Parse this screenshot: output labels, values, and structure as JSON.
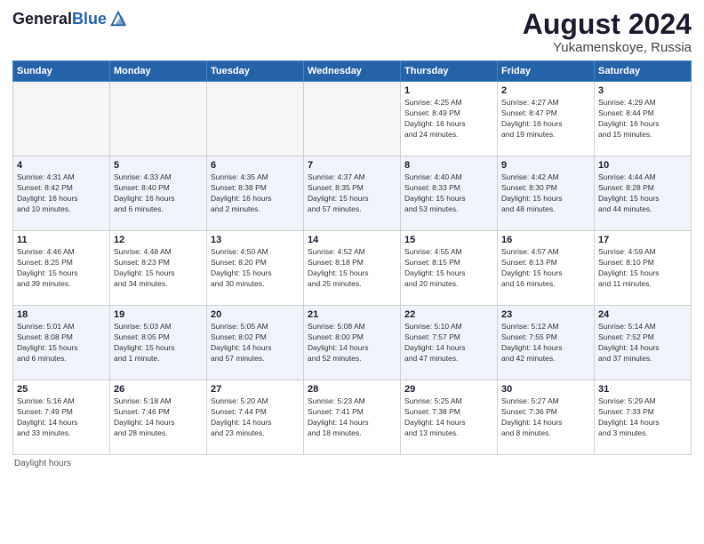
{
  "header": {
    "logo_general": "General",
    "logo_blue": "Blue",
    "month_year": "August 2024",
    "location": "Yukamenskoye, Russia"
  },
  "footer": {
    "daylight_label": "Daylight hours"
  },
  "days_of_week": [
    "Sunday",
    "Monday",
    "Tuesday",
    "Wednesday",
    "Thursday",
    "Friday",
    "Saturday"
  ],
  "weeks": [
    [
      {
        "day": "",
        "info": ""
      },
      {
        "day": "",
        "info": ""
      },
      {
        "day": "",
        "info": ""
      },
      {
        "day": "",
        "info": ""
      },
      {
        "day": "1",
        "info": "Sunrise: 4:25 AM\nSunset: 8:49 PM\nDaylight: 16 hours\nand 24 minutes."
      },
      {
        "day": "2",
        "info": "Sunrise: 4:27 AM\nSunset: 8:47 PM\nDaylight: 16 hours\nand 19 minutes."
      },
      {
        "day": "3",
        "info": "Sunrise: 4:29 AM\nSunset: 8:44 PM\nDaylight: 16 hours\nand 15 minutes."
      }
    ],
    [
      {
        "day": "4",
        "info": "Sunrise: 4:31 AM\nSunset: 8:42 PM\nDaylight: 16 hours\nand 10 minutes."
      },
      {
        "day": "5",
        "info": "Sunrise: 4:33 AM\nSunset: 8:40 PM\nDaylight: 16 hours\nand 6 minutes."
      },
      {
        "day": "6",
        "info": "Sunrise: 4:35 AM\nSunset: 8:38 PM\nDaylight: 16 hours\nand 2 minutes."
      },
      {
        "day": "7",
        "info": "Sunrise: 4:37 AM\nSunset: 8:35 PM\nDaylight: 15 hours\nand 57 minutes."
      },
      {
        "day": "8",
        "info": "Sunrise: 4:40 AM\nSunset: 8:33 PM\nDaylight: 15 hours\nand 53 minutes."
      },
      {
        "day": "9",
        "info": "Sunrise: 4:42 AM\nSunset: 8:30 PM\nDaylight: 15 hours\nand 48 minutes."
      },
      {
        "day": "10",
        "info": "Sunrise: 4:44 AM\nSunset: 8:28 PM\nDaylight: 15 hours\nand 44 minutes."
      }
    ],
    [
      {
        "day": "11",
        "info": "Sunrise: 4:46 AM\nSunset: 8:25 PM\nDaylight: 15 hours\nand 39 minutes."
      },
      {
        "day": "12",
        "info": "Sunrise: 4:48 AM\nSunset: 8:23 PM\nDaylight: 15 hours\nand 34 minutes."
      },
      {
        "day": "13",
        "info": "Sunrise: 4:50 AM\nSunset: 8:20 PM\nDaylight: 15 hours\nand 30 minutes."
      },
      {
        "day": "14",
        "info": "Sunrise: 4:52 AM\nSunset: 8:18 PM\nDaylight: 15 hours\nand 25 minutes."
      },
      {
        "day": "15",
        "info": "Sunrise: 4:55 AM\nSunset: 8:15 PM\nDaylight: 15 hours\nand 20 minutes."
      },
      {
        "day": "16",
        "info": "Sunrise: 4:57 AM\nSunset: 8:13 PM\nDaylight: 15 hours\nand 16 minutes."
      },
      {
        "day": "17",
        "info": "Sunrise: 4:59 AM\nSunset: 8:10 PM\nDaylight: 15 hours\nand 11 minutes."
      }
    ],
    [
      {
        "day": "18",
        "info": "Sunrise: 5:01 AM\nSunset: 8:08 PM\nDaylight: 15 hours\nand 6 minutes."
      },
      {
        "day": "19",
        "info": "Sunrise: 5:03 AM\nSunset: 8:05 PM\nDaylight: 15 hours\nand 1 minute."
      },
      {
        "day": "20",
        "info": "Sunrise: 5:05 AM\nSunset: 8:02 PM\nDaylight: 14 hours\nand 57 minutes."
      },
      {
        "day": "21",
        "info": "Sunrise: 5:08 AM\nSunset: 8:00 PM\nDaylight: 14 hours\nand 52 minutes."
      },
      {
        "day": "22",
        "info": "Sunrise: 5:10 AM\nSunset: 7:57 PM\nDaylight: 14 hours\nand 47 minutes."
      },
      {
        "day": "23",
        "info": "Sunrise: 5:12 AM\nSunset: 7:55 PM\nDaylight: 14 hours\nand 42 minutes."
      },
      {
        "day": "24",
        "info": "Sunrise: 5:14 AM\nSunset: 7:52 PM\nDaylight: 14 hours\nand 37 minutes."
      }
    ],
    [
      {
        "day": "25",
        "info": "Sunrise: 5:16 AM\nSunset: 7:49 PM\nDaylight: 14 hours\nand 33 minutes."
      },
      {
        "day": "26",
        "info": "Sunrise: 5:18 AM\nSunset: 7:46 PM\nDaylight: 14 hours\nand 28 minutes."
      },
      {
        "day": "27",
        "info": "Sunrise: 5:20 AM\nSunset: 7:44 PM\nDaylight: 14 hours\nand 23 minutes."
      },
      {
        "day": "28",
        "info": "Sunrise: 5:23 AM\nSunset: 7:41 PM\nDaylight: 14 hours\nand 18 minutes."
      },
      {
        "day": "29",
        "info": "Sunrise: 5:25 AM\nSunset: 7:38 PM\nDaylight: 14 hours\nand 13 minutes."
      },
      {
        "day": "30",
        "info": "Sunrise: 5:27 AM\nSunset: 7:36 PM\nDaylight: 14 hours\nand 8 minutes."
      },
      {
        "day": "31",
        "info": "Sunrise: 5:29 AM\nSunset: 7:33 PM\nDaylight: 14 hours\nand 3 minutes."
      }
    ]
  ]
}
